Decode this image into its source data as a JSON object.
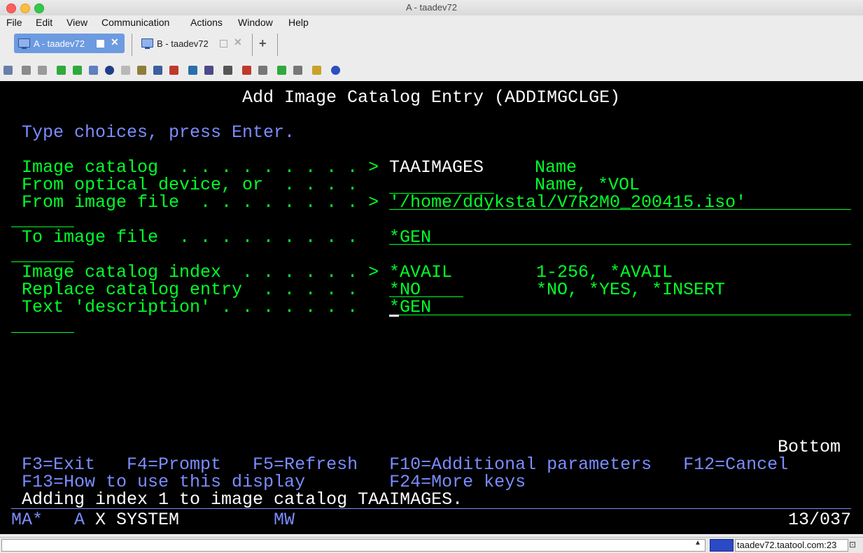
{
  "window": {
    "title": "A - taadev72"
  },
  "menu": [
    "File",
    "Edit",
    "View",
    "Communication",
    "Actions",
    "Window",
    "Help"
  ],
  "tabs": [
    {
      "label": "A - taadev72",
      "active": true
    },
    {
      "label": "B - taadev72",
      "active": false
    }
  ],
  "add_tab": "+",
  "toolbar_icons": [
    "copy-icon",
    "paste-icon",
    "clipboard-icon",
    "upload-icon",
    "download-icon",
    "print-icon",
    "compass-icon",
    "document-icon",
    "database-icon",
    "settings-icon",
    "macro-icon",
    "keypad-icon",
    "mail-icon",
    "grid-icon",
    "edit-icon",
    "record-icon",
    "stop-icon",
    "play-icon",
    "pause-icon",
    "notes-icon",
    "help-icon"
  ],
  "screen": {
    "title": "Add Image Catalog Entry (ADDIMGCLGE)",
    "instruction": "Type choices, press Enter.",
    "fields": [
      {
        "label": "Image catalog  . . . . . . . . . >",
        "value": "TAAIMAGES",
        "hint": "Name"
      },
      {
        "label": "From optical device, or  . . . .",
        "value": "",
        "hint": "Name, *VOL"
      },
      {
        "label": "From image file  . . . . . . . . >",
        "value": "'/home/ddykstal/V7R2M0_200415.iso'",
        "hint": ""
      },
      {
        "label": "To image file  . . . . . . . . .",
        "value": "*GEN",
        "hint": ""
      },
      {
        "label": "Image catalog index  . . . . . . >",
        "value": "*AVAIL",
        "hint": "1-256, *AVAIL"
      },
      {
        "label": "Replace catalog entry  . . . . .",
        "value": "*NO",
        "hint": "*NO, *YES, *INSERT"
      },
      {
        "label": "Text 'description' . . . . . . .",
        "value": "*GEN",
        "hint": ""
      }
    ],
    "bottom": "Bottom",
    "fkeys_line1": "F3=Exit   F4=Prompt   F5=Refresh   F10=Additional parameters   F12=Cancel",
    "fkeys_line2": "F13=How to use this display        F24=More keys",
    "message": "Adding index 1 to image catalog TAAIMAGES.",
    "status": {
      "mode": "MA*",
      "session": "A",
      "system": "X SYSTEM",
      "indicator": "MW",
      "cursor_pos": "13/037"
    }
  },
  "statusbar": {
    "host": "taadev72.taatool.com:23"
  },
  "colors": {
    "field_green": "#00ff29",
    "text_blue": "#7b8cff",
    "text_white": "#ffffff",
    "tab_active": "#6d9be0"
  }
}
